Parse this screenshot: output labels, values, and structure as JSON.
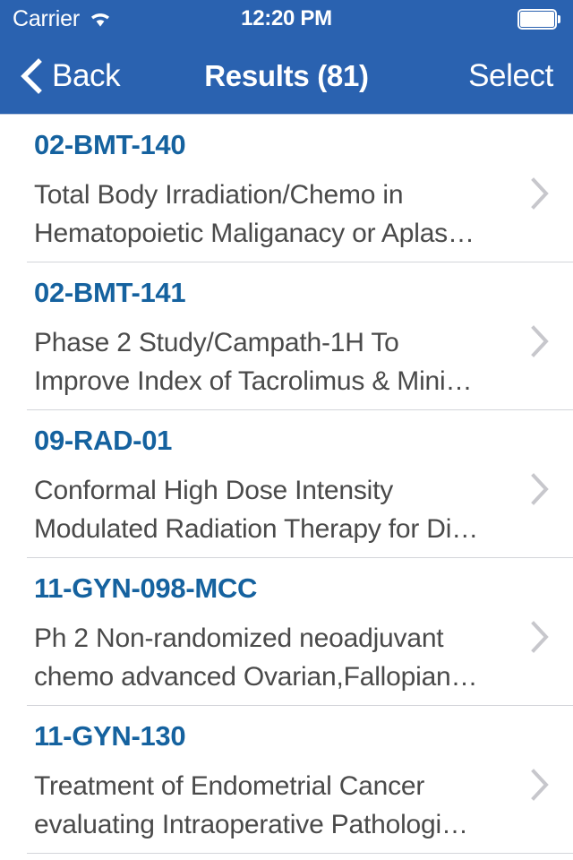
{
  "status_bar": {
    "carrier": "Carrier",
    "wifi_icon": "wifi-icon",
    "time": "12:20 PM",
    "battery_icon": "battery-full-icon"
  },
  "nav_bar": {
    "back_icon": "chevron-left-icon",
    "back_label": "Back",
    "title": "Results (81)",
    "select_label": "Select",
    "background_color": "#2a62b0"
  },
  "theme": {
    "nav_blue": "#2a62b0",
    "id_blue": "#15629f",
    "body_gray": "#4a4a4a",
    "separator": "#d3d5da",
    "chevron_gray": "#c7c7cc"
  },
  "list": {
    "disclosure_icon": "chevron-right-icon",
    "items": [
      {
        "id": "02-BMT-140",
        "description": "Total Body Irradiation/Chemo in\nHematopoietic Maliganacy or Aplas…"
      },
      {
        "id": "02-BMT-141",
        "description": "Phase 2 Study/Campath-1H To\nImprove Index of Tacrolimus & Mini…"
      },
      {
        "id": "09-RAD-01",
        "description": "Conformal High Dose Intensity\nModulated Radiation Therapy for Di…"
      },
      {
        "id": "11-GYN-098-MCC",
        "description": "Ph 2 Non-randomized neoadjuvant\nchemo advanced Ovarian,Fallopian…"
      },
      {
        "id": "11-GYN-130",
        "description": "Treatment of Endometrial Cancer\nevaluating Intraoperative Pathologi…"
      }
    ]
  }
}
